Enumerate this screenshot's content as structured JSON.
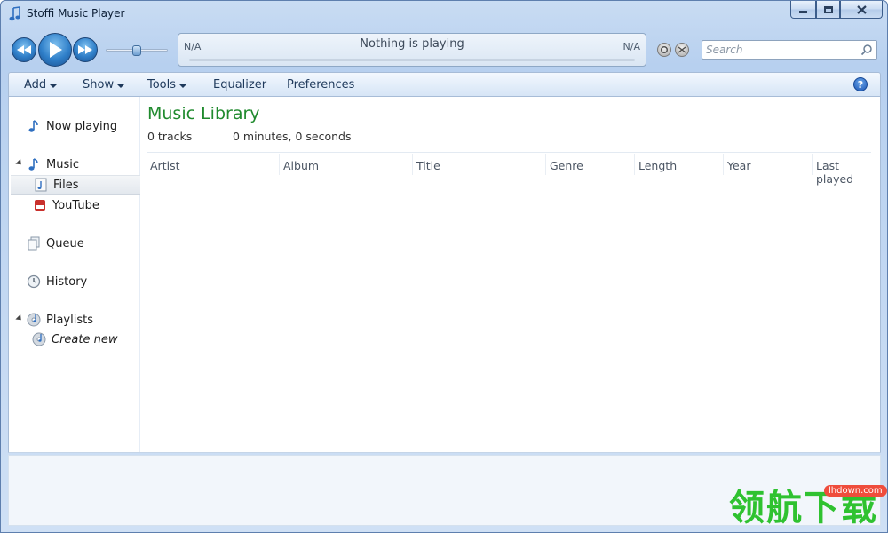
{
  "window": {
    "title": "Stoffi Music Player"
  },
  "player": {
    "volume_level": 0.5,
    "progress": 0,
    "position_text": "N/A",
    "length_text": "N/A",
    "now_playing": "Nothing is playing"
  },
  "search": {
    "placeholder": "Search"
  },
  "menu": {
    "items": [
      {
        "label": "Add",
        "has_dropdown": true
      },
      {
        "label": "Show",
        "has_dropdown": true
      },
      {
        "label": "Tools",
        "has_dropdown": true
      },
      {
        "label": "Equalizer",
        "has_dropdown": false
      },
      {
        "label": "Preferences",
        "has_dropdown": false
      }
    ],
    "help_glyph": "?"
  },
  "navigation": {
    "now_playing": "Now playing",
    "music": "Music",
    "files": "Files",
    "youtube": "YouTube",
    "queue": "Queue",
    "history": "History",
    "playlists": "Playlists",
    "create_new": "Create new"
  },
  "library": {
    "title": "Music Library",
    "track_count": "0 tracks",
    "duration": "0 minutes, 0 seconds",
    "columns": [
      "Artist",
      "Album",
      "Title",
      "Genre",
      "Length",
      "Year",
      "Last played"
    ],
    "rows": []
  },
  "watermark": {
    "text": "领航下载",
    "badge": "lhdown.com"
  },
  "colors": {
    "accent": "#1f8a2d",
    "frame": "#b7d0ef",
    "watermark_green": "#2fc230"
  }
}
